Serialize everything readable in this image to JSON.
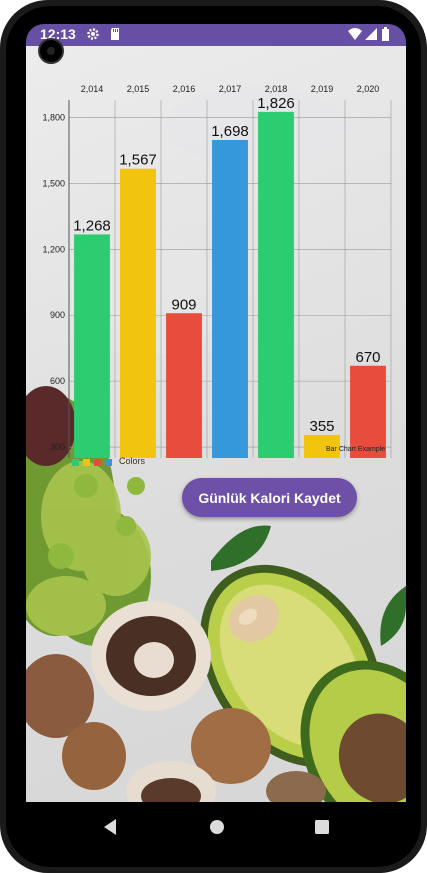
{
  "status_bar": {
    "time": "12:13",
    "color": "#6750a4",
    "icons": [
      "gear-icon",
      "sd-card-icon",
      "wifi-icon",
      "signal-icon",
      "battery-icon"
    ]
  },
  "chart_data": {
    "type": "bar",
    "categories": [
      "2,014",
      "2,015",
      "2,016",
      "2,017",
      "2,018",
      "2,019",
      "2,020"
    ],
    "values": [
      1268,
      1567,
      909,
      1698,
      1826,
      355,
      670
    ],
    "value_labels": [
      "1,268",
      "1,567",
      "909",
      "1,698",
      "1,826",
      "355",
      "670"
    ],
    "colors": [
      "#2ecc71",
      "#f1c40f",
      "#e74c3c",
      "#3498db",
      "#2ecc71",
      "#f1c40f",
      "#e74c3c"
    ],
    "y_ticks": [
      300,
      600,
      900,
      1200,
      1500,
      1800
    ],
    "y_tick_labels": [
      "300",
      "600",
      "900",
      "1,200",
      "1,500",
      "1,800"
    ],
    "ylim": [
      250,
      1880
    ],
    "x_axis_position": "top",
    "grid": true,
    "legend": {
      "label": "Colors",
      "colors": [
        "#2ecc71",
        "#f1c40f",
        "#e74c3c",
        "#3498db"
      ],
      "placement": "bottom-left"
    },
    "description": "Bar Chart Example"
  },
  "save_button": {
    "label": "Günlük Kalori Kaydet",
    "color": "#6e50a8"
  },
  "nav": {
    "icons": [
      "back-icon",
      "home-icon",
      "recents-icon"
    ]
  }
}
